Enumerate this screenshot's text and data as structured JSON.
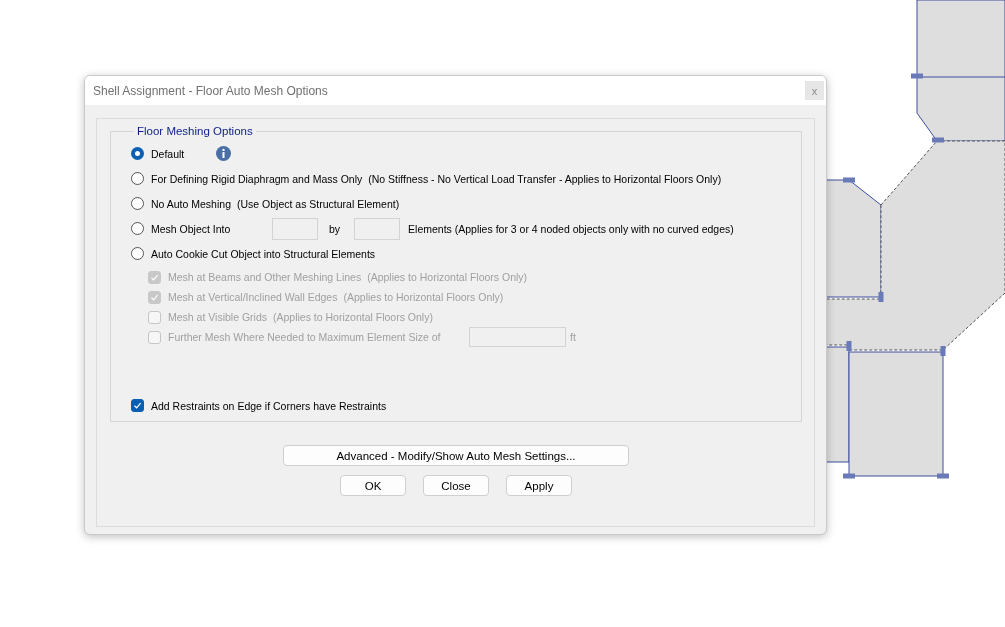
{
  "window": {
    "title": "Shell Assignment - Floor Auto Mesh Options",
    "close_glyph": "x"
  },
  "group": {
    "title": "Floor Meshing Options",
    "options": [
      {
        "kind": "info",
        "label": "Default",
        "selected": true
      },
      {
        "kind": "plain",
        "label": "For Defining Rigid Diaphragm and Mass Only",
        "note": "(No Stiffness - No Vertical Load Transfer - Applies to Horizontal Floors Only)",
        "selected": false
      },
      {
        "kind": "plain",
        "label": "No Auto Meshing",
        "note": "(Use Object as Structural Element)",
        "selected": false
      },
      {
        "kind": "divisions",
        "label": "Mesh Object Into",
        "joiner": "by",
        "suffix": "Elements (Applies for 3 or 4 noded objects only with no curved edges)",
        "selected": false
      },
      {
        "kind": "plain",
        "label": "Auto Cookie Cut Object into Structural Elements",
        "selected": false
      }
    ],
    "sub_options": [
      {
        "kind": "plain",
        "label": "Mesh at Beams and Other Meshing Lines",
        "note": "(Applies to Horizontal Floors Only)",
        "checked": true,
        "disabled": true
      },
      {
        "kind": "plain",
        "label": "Mesh at Vertical/Inclined Wall Edges",
        "note": "(Applies to Horizontal Floors Only)",
        "checked": true,
        "disabled": true
      },
      {
        "kind": "plain",
        "label": "Mesh at Visible Grids",
        "note": "(Applies to Horizontal Floors Only)",
        "checked": false,
        "disabled": true
      },
      {
        "kind": "size",
        "label": "Further Mesh Where Needed to Maximum Element Size of",
        "unit": "ft",
        "checked": false,
        "disabled": true
      }
    ],
    "restraint": {
      "label": "Add Restraints on Edge if Corners have Restraints",
      "checked": true,
      "disabled": false
    }
  },
  "advanced_button": "Advanced - Modify/Show Auto Mesh Settings...",
  "buttons": [
    "OK",
    "Close",
    "Apply"
  ]
}
